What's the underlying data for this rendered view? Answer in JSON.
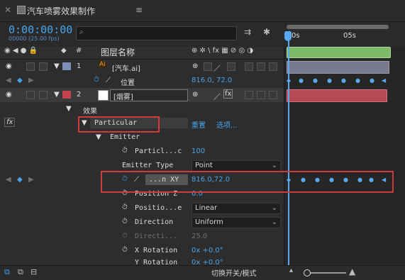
{
  "window": {
    "title": "汽车喷雾效果制作"
  },
  "header": {
    "timecode": "0:00:00:00",
    "fps": "00000 (25.00 fps)",
    "search_placeholder": ""
  },
  "ruler": {
    "mark1": "0s",
    "mark2": "05s"
  },
  "columns": {
    "name_header": "图层名称",
    "num_header": "#"
  },
  "layers": [
    {
      "num": "1",
      "name": "[汽车.ai]",
      "tag": "#7e8fb8"
    },
    {
      "num": "2",
      "name": "[烟雾]",
      "tag": "#c0434e"
    }
  ],
  "properties": {
    "position_label": "位置",
    "position_value": "816.0, 72.0",
    "effects_label": "效果",
    "effect_name": "Particular",
    "reset_label": "重置",
    "options_label": "选项...",
    "emitter_label": "Emitter",
    "particles_label": "Particl...c",
    "particles_value": "100",
    "emitter_type_label": "Emitter Type",
    "emitter_type_value": "Point",
    "xy_label": "...n XY",
    "xy_value": "816.0,72.0",
    "pos_z_label": "Position Z",
    "pos_z_value": "0.0",
    "pos_sub_label": "Positio...e",
    "pos_sub_value": "Linear",
    "direction_label": "Direction",
    "direction_value": "Uniform",
    "directi_label": "Directi...",
    "directi_value": "25.0",
    "xrot_label": "X Rotation",
    "xrot_value": "0x +0.0°",
    "yrot_label": "Y Rotation",
    "yrot_value": "0x +0.0°"
  },
  "footer": {
    "toggle_label": "切换开关/模式"
  },
  "colors": {
    "accent": "#4aa3e8",
    "highlight": "#d03a3a",
    "work_area": "#7dba67"
  }
}
